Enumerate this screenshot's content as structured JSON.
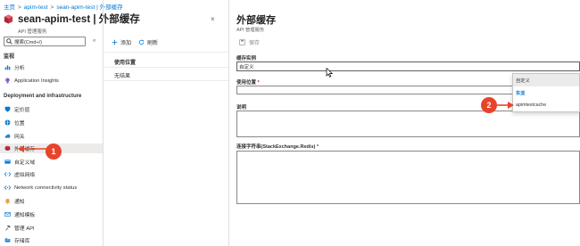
{
  "breadcrumb": [
    "主页",
    "apim-test",
    "sean-apim-test | 外部缓存"
  ],
  "header": {
    "title": "sean-apim-test | 外部缓存",
    "subtitle": "API 管理服务"
  },
  "sidebar": {
    "search_placeholder": "搜索(Cmd+/)",
    "collapse_glyph": "«",
    "close_glyph": "×",
    "sections": [
      {
        "label": "监视"
      },
      {
        "label": "Deployment and infrastructure"
      }
    ],
    "items": [
      {
        "label": "分析",
        "icon": "analytics-icon"
      },
      {
        "label": "Application Insights",
        "icon": "application-insights-icon"
      },
      {
        "label": "定价层",
        "icon": "pricing-tier-icon"
      },
      {
        "label": "位置",
        "icon": "locations-icon"
      },
      {
        "label": "网关",
        "icon": "gateways-icon"
      },
      {
        "label": "外部缓存",
        "icon": "external-cache-icon",
        "active": true
      },
      {
        "label": "自定义域",
        "icon": "custom-domains-icon"
      },
      {
        "label": "虚拟网络",
        "icon": "virtual-network-icon"
      },
      {
        "label": "Network connectivity status",
        "icon": "network-status-icon"
      },
      {
        "label": "通知",
        "icon": "notifications-icon"
      },
      {
        "label": "通知模板",
        "icon": "notification-templates-icon"
      },
      {
        "label": "管理 API",
        "icon": "management-api-icon"
      },
      {
        "label": "存储库",
        "icon": "repository-icon"
      }
    ]
  },
  "middle": {
    "add_label": "添加",
    "refresh_label": "刷新",
    "column_header": "使用位置",
    "empty_text": "无结果"
  },
  "panel": {
    "title": "外部缓存",
    "subtitle": "API 管理服务",
    "save_label": "保存",
    "cache_instance_label": "缓存实例",
    "cache_instance_value": "自定义",
    "usage_location_label": "使用位置",
    "required_mark": "*",
    "description_label": "说明",
    "connection_label": "连接字符串(StackExchange.Redis)",
    "dropdown_options": [
      {
        "label": "自定义",
        "kind": "selected"
      },
      {
        "label": "东亚",
        "kind": "group"
      },
      {
        "label": "apimtestcache",
        "kind": "option"
      }
    ]
  },
  "annotations": [
    "1",
    "2"
  ],
  "colors": {
    "accent": "#0078d4",
    "badge": "#e8442c",
    "active_bg": "#edebe9",
    "border": "#8a8886"
  }
}
